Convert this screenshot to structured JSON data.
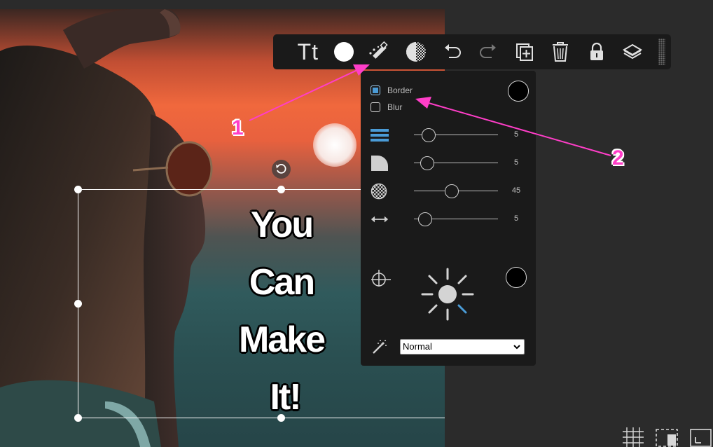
{
  "canvas": {
    "text_lines": [
      "You",
      "Can",
      "Make",
      "It!"
    ]
  },
  "toolbar": {
    "text_tool_label": "Tt",
    "items": [
      "text-icon",
      "color-icon",
      "effects-wand-icon",
      "opacity-icon",
      "undo-icon",
      "redo-icon",
      "duplicate-icon",
      "delete-icon",
      "lock-icon",
      "layers-icon"
    ]
  },
  "effects_panel": {
    "border_label": "Border",
    "border_checked": true,
    "blur_label": "Blur",
    "blur_checked": false,
    "sliders": [
      {
        "icon": "line-weight-icon",
        "value": "5"
      },
      {
        "icon": "corner-radius-icon",
        "value": "5"
      },
      {
        "icon": "transparency-icon",
        "value": "45"
      },
      {
        "icon": "spacing-icon",
        "value": "5"
      }
    ],
    "shadow_icon": "shadow-offset-icon",
    "shadow_color": "#000000",
    "border_color": "#000000",
    "blend_icon": "magic-wand-icon",
    "blend_mode": "Normal"
  },
  "annotations": {
    "arrow_1_label": "1",
    "arrow_2_label": "2",
    "color": "#ff3ec8"
  },
  "corner_controls": [
    "grid-icon",
    "crop-select-icon",
    "fullscreen-icon"
  ]
}
